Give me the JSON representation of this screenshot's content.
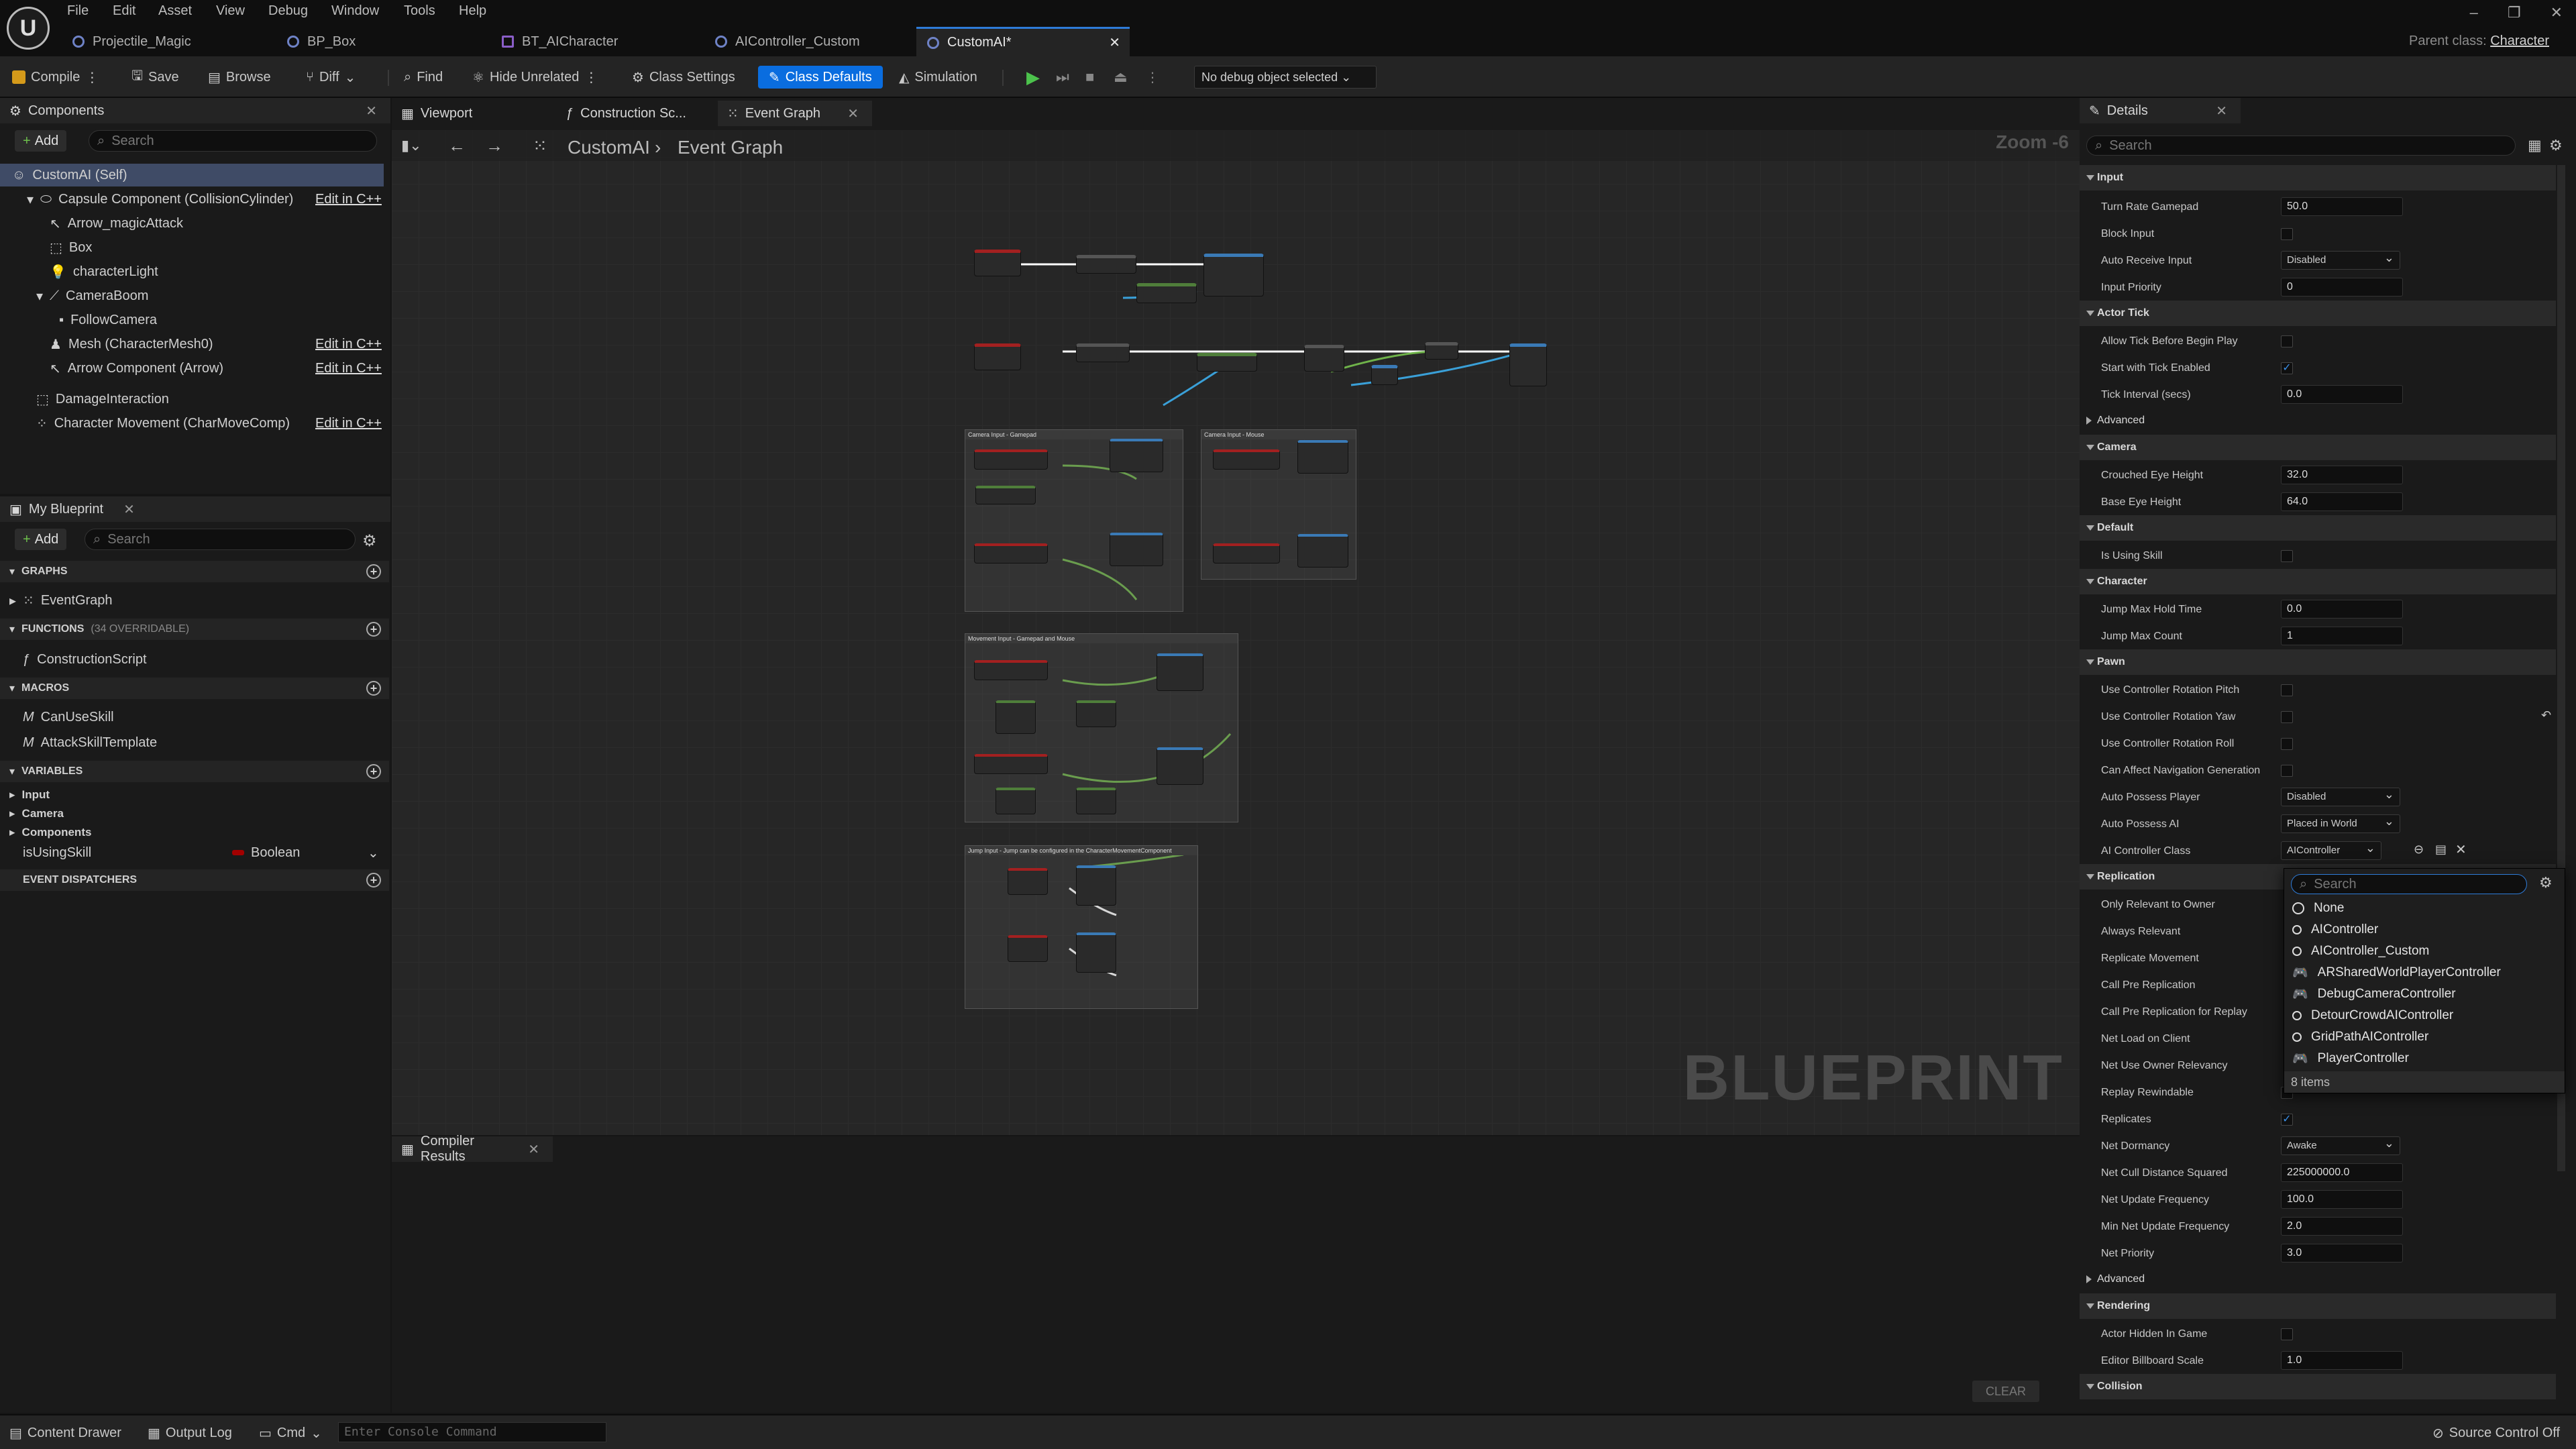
{
  "menu": [
    "File",
    "Edit",
    "Asset",
    "View",
    "Debug",
    "Window",
    "Tools",
    "Help"
  ],
  "doc_tabs": [
    "Projectile_Magic",
    "BP_Box",
    "BT_AICharacter",
    "AIController_Custom",
    "CustomAI*"
  ],
  "parent_class": {
    "label": "Parent class:",
    "value": "Character"
  },
  "toolbar": {
    "compile": "Compile",
    "save": "Save",
    "browse": "Browse",
    "diff": "Diff",
    "find": "Find",
    "hide_unrelated": "Hide Unrelated",
    "class_settings": "Class Settings",
    "class_defaults": "Class Defaults",
    "simulation": "Simulation",
    "debug_object": "No debug object selected"
  },
  "components": {
    "tab": "Components",
    "add": "Add",
    "search_placeholder": "Search",
    "items": [
      {
        "label": "CustomAI (Self)"
      },
      {
        "label": "Capsule Component (CollisionCylinder)",
        "edit": "Edit in C++"
      },
      {
        "label": "Arrow_magicAttack"
      },
      {
        "label": "Box"
      },
      {
        "label": "characterLight"
      },
      {
        "label": "CameraBoom"
      },
      {
        "label": "FollowCamera"
      },
      {
        "label": "Mesh (CharacterMesh0)",
        "edit": "Edit in C++"
      },
      {
        "label": "Arrow Component (Arrow)",
        "edit": "Edit in C++"
      },
      {
        "label": "DamageInteraction"
      },
      {
        "label": "Character Movement (CharMoveComp)",
        "edit": "Edit in C++"
      }
    ]
  },
  "my_blueprint": {
    "tab": "My Blueprint",
    "add": "Add",
    "search_placeholder": "Search",
    "graphs": "GRAPHS",
    "event_graph": "EventGraph",
    "functions": "FUNCTIONS",
    "functions_count": "(34 OVERRIDABLE)",
    "construction_script": "ConstructionScript",
    "macros": "MACROS",
    "macro_items": [
      "CanUseSkill",
      "AttackSkillTemplate"
    ],
    "variables": "VARIABLES",
    "var_groups": [
      "Input",
      "Camera",
      "Components"
    ],
    "var_name": "isUsingSkill",
    "var_type": "Boolean",
    "event_dispatchers": "EVENT DISPATCHERS"
  },
  "editor_tabs": [
    "Viewport",
    "Construction Sc...",
    "Event Graph"
  ],
  "graph": {
    "breadcrumb_root": "CustomAI",
    "breadcrumb_leaf": "Event Graph",
    "zoom": "Zoom -6",
    "watermark": "BLUEPRINT",
    "comments": [
      "Camera Input - Gamepad",
      "Camera Input - Mouse",
      "Movement Input - Gamepad and Mouse",
      "Jump Input - Jump can be configured in the CharacterMovementComponent"
    ]
  },
  "compiler": {
    "tab": "Compiler Results",
    "clear": "CLEAR"
  },
  "details": {
    "tab": "Details",
    "search_placeholder": "Search",
    "sections": {
      "input": "Input",
      "actor_tick": "Actor Tick",
      "advanced": "Advanced",
      "camera": "Camera",
      "default": "Default",
      "character": "Character",
      "pawn": "Pawn",
      "replication": "Replication",
      "rendering": "Rendering",
      "collision": "Collision"
    },
    "props": {
      "turn_rate": {
        "label": "Turn Rate Gamepad",
        "value": "50.0"
      },
      "block_input": {
        "label": "Block Input"
      },
      "auto_receive": {
        "label": "Auto Receive Input",
        "value": "Disabled"
      },
      "input_priority": {
        "label": "Input Priority",
        "value": "0"
      },
      "allow_tick": {
        "label": "Allow Tick Before Begin Play"
      },
      "start_tick": {
        "label": "Start with Tick Enabled"
      },
      "tick_interval": {
        "label": "Tick Interval (secs)",
        "value": "0.0"
      },
      "crouched_eye": {
        "label": "Crouched Eye Height",
        "value": "32.0"
      },
      "base_eye": {
        "label": "Base Eye Height",
        "value": "64.0"
      },
      "is_using_skill": {
        "label": "Is Using Skill"
      },
      "jump_hold": {
        "label": "Jump Max Hold Time",
        "value": "0.0"
      },
      "jump_count": {
        "label": "Jump Max Count",
        "value": "1"
      },
      "ucr_pitch": {
        "label": "Use Controller Rotation Pitch"
      },
      "ucr_yaw": {
        "label": "Use Controller Rotation Yaw"
      },
      "ucr_roll": {
        "label": "Use Controller Rotation Roll"
      },
      "can_affect_nav": {
        "label": "Can Affect Navigation Generation"
      },
      "auto_possess_player": {
        "label": "Auto Possess Player",
        "value": "Disabled"
      },
      "auto_possess_ai": {
        "label": "Auto Possess AI",
        "value": "Placed in World"
      },
      "ai_controller_class": {
        "label": "AI Controller Class",
        "value": "AIController"
      },
      "only_relevant": {
        "label": "Only Relevant to Owner"
      },
      "always_relevant": {
        "label": "Always Relevant"
      },
      "replicate_movement": {
        "label": "Replicate Movement"
      },
      "call_pre_rep": {
        "label": "Call Pre Replication"
      },
      "call_pre_rep_replay": {
        "label": "Call Pre Replication for Replay"
      },
      "net_load": {
        "label": "Net Load on Client"
      },
      "net_use_owner": {
        "label": "Net Use Owner Relevancy"
      },
      "replay_rewind": {
        "label": "Replay Rewindable"
      },
      "replicates": {
        "label": "Replicates"
      },
      "net_dormancy": {
        "label": "Net Dormancy",
        "value": "Awake"
      },
      "net_cull": {
        "label": "Net Cull Distance Squared",
        "value": "225000000.0"
      },
      "net_update": {
        "label": "Net Update Frequency",
        "value": "100.0"
      },
      "min_net_update": {
        "label": "Min Net Update Frequency",
        "value": "2.0"
      },
      "net_priority": {
        "label": "Net Priority",
        "value": "3.0"
      },
      "actor_hidden": {
        "label": "Actor Hidden In Game"
      },
      "billboard_scale": {
        "label": "Editor Billboard Scale",
        "value": "1.0"
      }
    },
    "popup": {
      "search_placeholder": "Search",
      "items": [
        "None",
        "AIController",
        "AIController_Custom",
        "ARSharedWorldPlayerController",
        "DebugCameraController",
        "DetourCrowdAIController",
        "GridPathAIController",
        "PlayerController"
      ],
      "count": "8 items"
    }
  },
  "status": {
    "content_drawer": "Content Drawer",
    "output_log": "Output Log",
    "cmd": "Cmd",
    "console_placeholder": "Enter Console Command",
    "source_control": "Source Control Off"
  }
}
